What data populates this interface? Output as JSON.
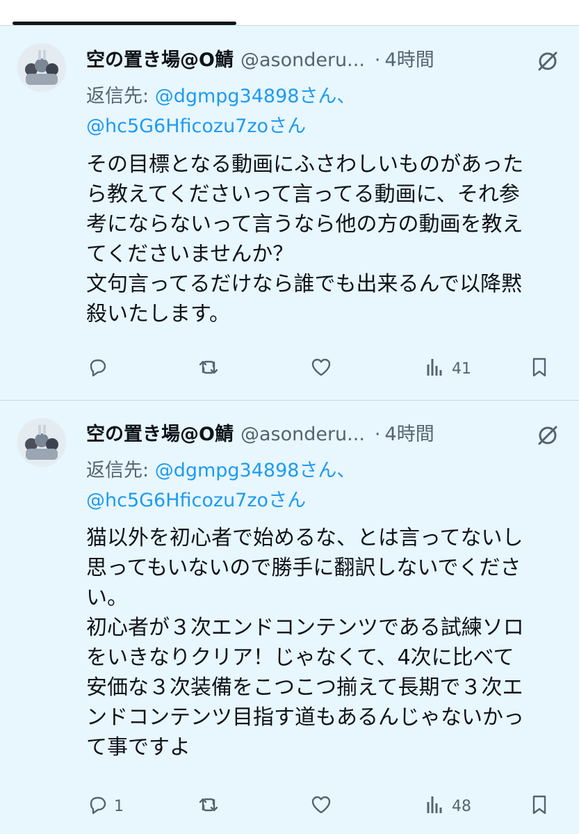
{
  "tweets": [
    {
      "display_name": "空の置き場@O鯖",
      "handle": "@asonderu...",
      "dot": "·",
      "time": "4時間",
      "reply_prefix": "返信先: ",
      "reply_to_1": "@dgmpg34898さん、",
      "reply_to_2": "@hc5G6Hficozu7zoさん",
      "body_lines": [
        "その目標となる動画にふさわしいものがあった",
        "ら教えてくださいって言ってる動画に、それ参",
        "考にならないって言うなら他の方の動画を教え",
        "てくださいませんか？",
        "文句言ってるだけなら誰でも出来るんで以降黙",
        "殺いたします。"
      ],
      "reply_count": "",
      "views": "41",
      "icons": [
        "reply-icon",
        "retweet-icon",
        "like-icon",
        "views-icon",
        "bookmark-icon",
        "grok-icon"
      ]
    },
    {
      "display_name": "空の置き場@O鯖",
      "handle": "@asonderu...",
      "dot": "·",
      "time": "4時間",
      "reply_prefix": "返信先: ",
      "reply_to_1": "@dgmpg34898さん、",
      "reply_to_2": "@hc5G6Hficozu7zoさん",
      "body_lines": [
        "猫以外を初心者で始めるな、とは言ってないし",
        "思ってもいないので勝手に翻訳しないでくださ",
        "い。",
        "初心者が３次エンドコンテンツである試練ソロ",
        "をいきなりクリア！じゃなくて、4次に比べて",
        "安価な３次装備をこつこつ揃えて長期で３次エ",
        "ンドコンテンツ目指す道もあるんじゃないかっ",
        "て事ですよ"
      ],
      "reply_count": "1",
      "views": "48",
      "icons": [
        "reply-icon",
        "retweet-icon",
        "like-icon",
        "views-icon",
        "bookmark-icon",
        "grok-icon"
      ]
    }
  ],
  "colors": {
    "background": "#e8f6fd",
    "link": "#1d9bf0",
    "secondary_text": "#536471",
    "primary_text": "#0f1419"
  }
}
